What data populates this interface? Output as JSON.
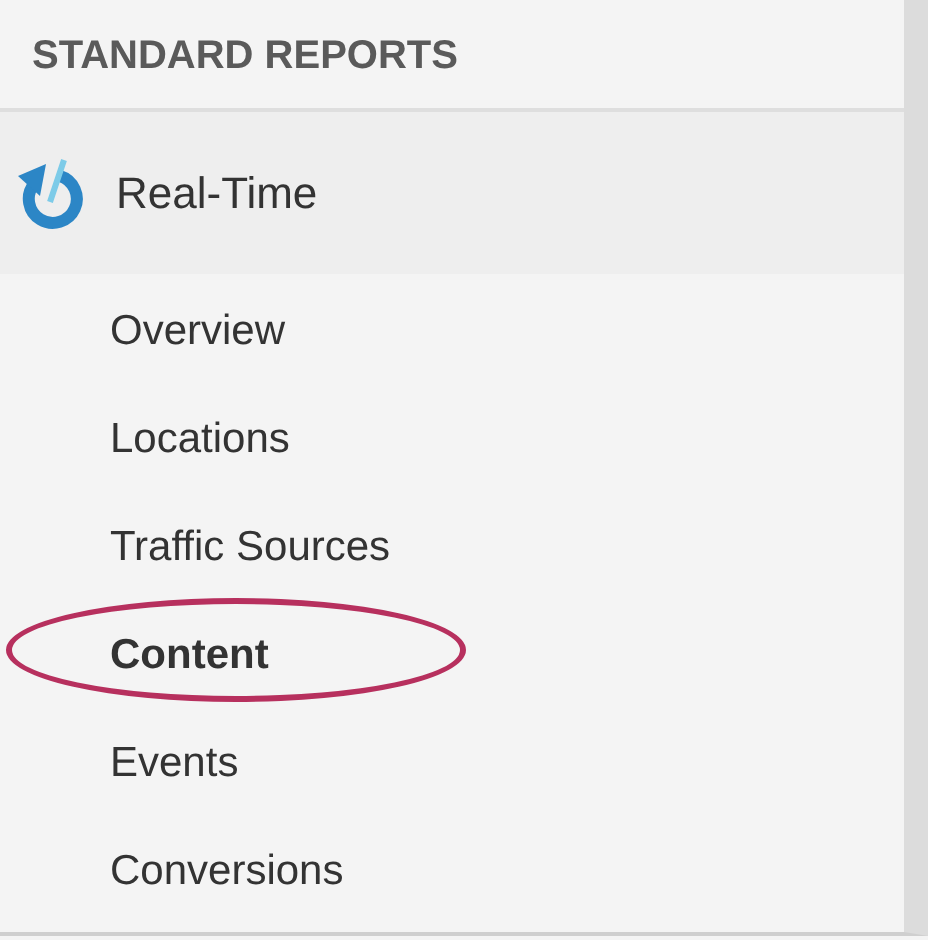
{
  "sidebar": {
    "heading": "STANDARD REPORTS",
    "section": {
      "label": "Real-Time"
    },
    "items": [
      {
        "label": "Overview",
        "selected": false
      },
      {
        "label": "Locations",
        "selected": false
      },
      {
        "label": "Traffic Sources",
        "selected": false
      },
      {
        "label": "Content",
        "selected": true
      },
      {
        "label": "Events",
        "selected": false
      },
      {
        "label": "Conversions",
        "selected": false
      }
    ]
  }
}
